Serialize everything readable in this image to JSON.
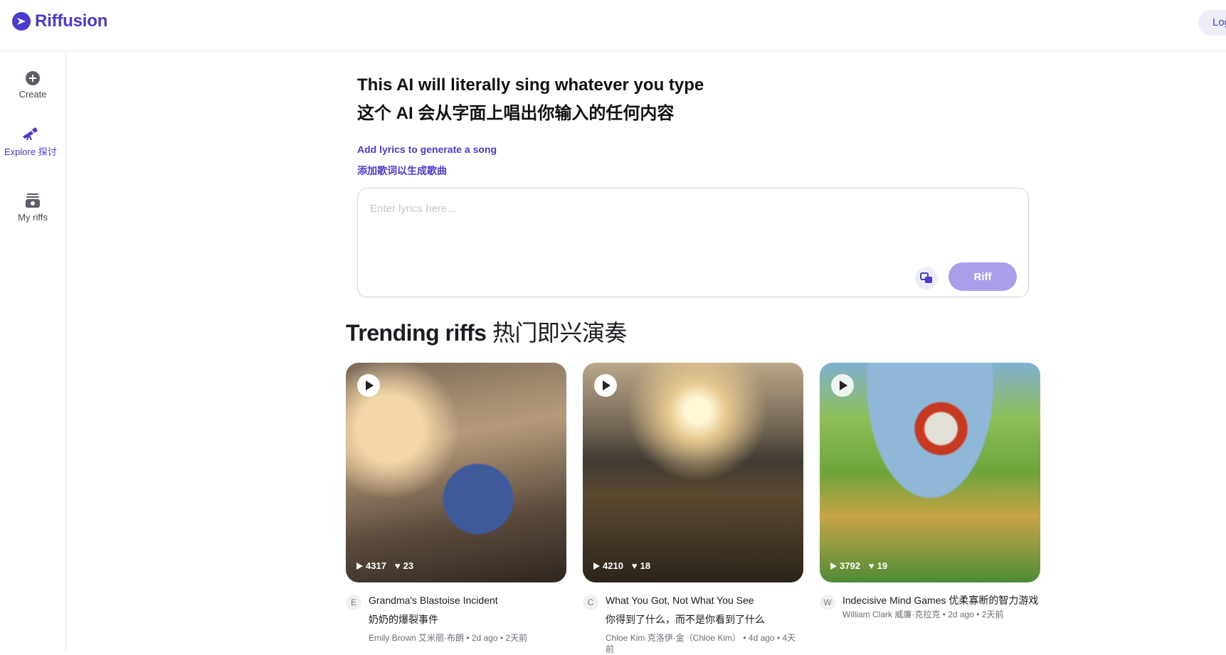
{
  "header": {
    "brand": "Riffusion",
    "login_label": "Log in"
  },
  "sidebar": {
    "items": [
      {
        "label": "Create",
        "icon": "plus-circle-icon"
      },
      {
        "label": "Explore 探讨",
        "icon": "telescope-icon"
      },
      {
        "label": "My riffs",
        "icon": "archive-box-icon"
      }
    ]
  },
  "hero": {
    "title_en": "This AI will literally sing whatever you type",
    "title_cn": "这个 AI 会从字面上唱出你输入的任何内容",
    "add_lyrics_en": "Add lyrics to generate a song",
    "add_lyrics_cn": "添加歌词以生成歌曲",
    "lyrics_placeholder": "Enter lyrics here...",
    "lyrics_value": "",
    "riff_button": "Riff"
  },
  "trending": {
    "title_en": "Trending riffs",
    "title_cn": "热门即兴演奏",
    "cards": [
      {
        "plays": "4317",
        "likes": "23",
        "avatar": "E",
        "title": "Grandma's Blastoise Incident",
        "title_cn": "奶奶的爆裂事件",
        "byline": "Emily Brown 艾米丽·布朗 • 2d ago • 2天前"
      },
      {
        "plays": "4210",
        "likes": "18",
        "avatar": "C",
        "title": "What You Got, Not What You See",
        "title_cn": "你得到了什么，而不是你看到了什么",
        "byline": "Chloe Kim 克洛伊·金（Chloe Kim） • 4d ago • 4天前"
      },
      {
        "plays": "3792",
        "likes": "19",
        "avatar": "W",
        "title": "Indecisive Mind Games 优柔寡断的智力游戏",
        "title_cn": "",
        "byline": "William Clark 威廉·克拉克 • 2d ago • 2天前"
      }
    ]
  },
  "colors": {
    "brand": "#4a3ad0",
    "riff_button": "#a89eea",
    "border": "#e6e6ec"
  }
}
